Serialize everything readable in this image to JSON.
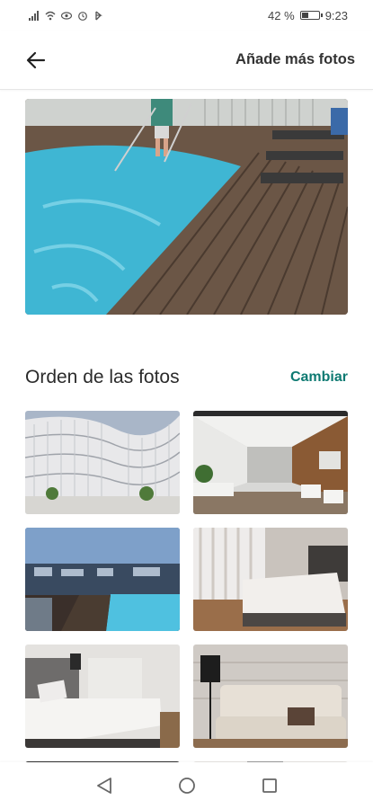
{
  "status_bar": {
    "battery_percent": "42 %",
    "time": "9:23",
    "battery_level": 0.42,
    "left_icons": [
      "signal-icon",
      "wifi-icon",
      "eye-icon",
      "alarm-icon",
      "data-icon"
    ]
  },
  "header": {
    "add_photos_label": "Añade más fotos"
  },
  "section": {
    "title": "Orden de las fotos",
    "change_label": "Cambiar"
  },
  "photos": [
    {
      "subject": "pool-terrace"
    },
    {
      "subject": "building-facade"
    },
    {
      "subject": "corridor"
    },
    {
      "subject": "rooftop-pool-night"
    },
    {
      "subject": "bedroom-curtains"
    },
    {
      "subject": "bedroom-grey"
    },
    {
      "subject": "sofa-living"
    }
  ],
  "colors": {
    "accent": "#0e7a72",
    "text": "#2b2b2b"
  }
}
